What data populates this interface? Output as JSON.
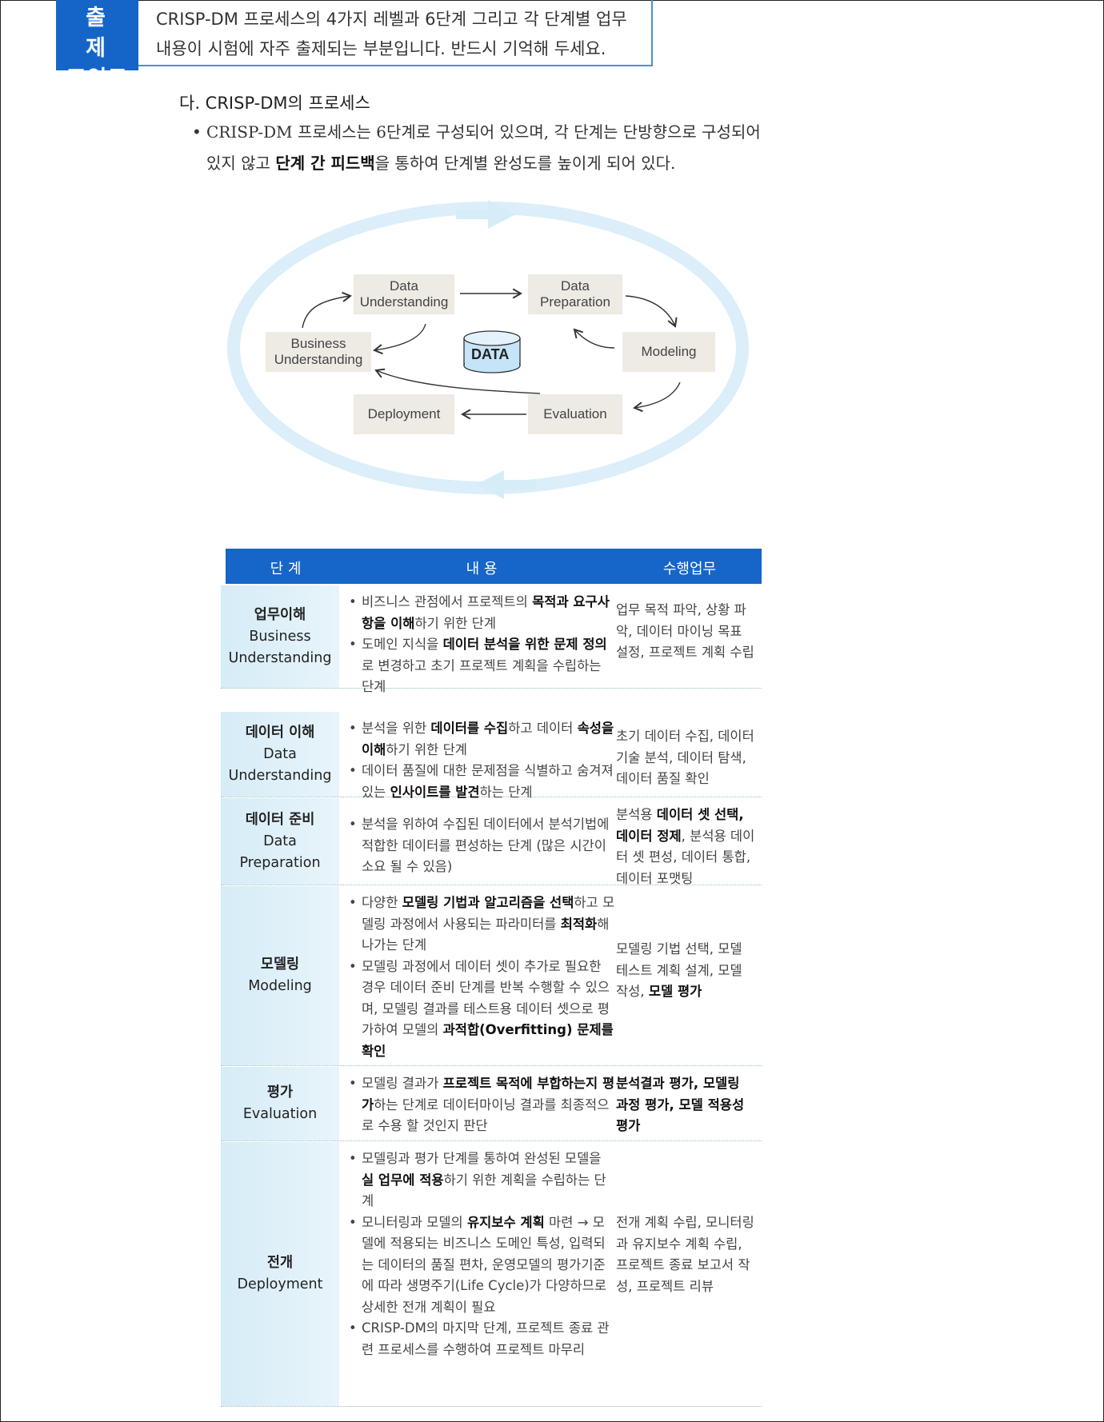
{
  "exam_point": {
    "badge_line1": "출 제",
    "badge_line2": "포인트",
    "text_line1": "CRISP-DM 프로세스의 4가지 레벨과 6단계 그리고 각 단계별 업무",
    "text_line2": "내용이 시험에 자주 출제되는 부분입니다. 반드시 기억해 두세요."
  },
  "section": {
    "title": "다. CRISP-DM의 프로세스",
    "bullet_pre": "CRISP-DM 프로세스는 6단계로 구성되어 있으며, 각 단계는 단방향으로 구성되어 있지 않고 ",
    "bullet_bold": "단계 간 피드백",
    "bullet_post": "을 통하여 단계별 완성도를 높이게 되어 있다."
  },
  "diagram": {
    "nodes": {
      "data_understanding": "Data Understanding",
      "data_preparation": "Data Preparation",
      "business_understanding": "Business Understanding",
      "modeling": "Modeling",
      "deployment": "Deployment",
      "evaluation": "Evaluation"
    },
    "database_label": "DATA"
  },
  "table": {
    "headers": [
      "단 계",
      "내 용",
      "수행업무"
    ],
    "rows": [
      {
        "stage_ko": "업무이해",
        "stage_en1": "Business",
        "stage_en2": "Understanding",
        "content": [
          [
            [
              "비즈니스 관점에서 프로젝트의 ",
              false
            ],
            [
              "목적과 요구사항을 이해",
              true
            ],
            [
              "하기 위한 단계",
              false
            ]
          ],
          [
            [
              "도메인 지식을 ",
              false
            ],
            [
              "데이터 분석을 위한 문제 정의",
              true
            ],
            [
              "로 변경하고 초기 프로젝트 계획을 수립하는 단계",
              false
            ]
          ]
        ],
        "task": [
          [
            "업무 목적 파악, 상황 파악, 데이터 마이닝 목표 설정, 프로젝트 계획 수립",
            false
          ]
        ]
      },
      {
        "stage_ko": "데이터 이해",
        "stage_en1": "Data",
        "stage_en2": "Understanding",
        "content": [
          [
            [
              "분석을 위한 ",
              false
            ],
            [
              "데이터를 수집",
              true
            ],
            [
              "하고 데이터 ",
              false
            ],
            [
              "속성을 이해",
              true
            ],
            [
              "하기 위한 단계",
              false
            ]
          ],
          [
            [
              "데이터 품질에 대한 문제점을 식별하고 숨겨져 있는 ",
              false
            ],
            [
              "인사이트를 발견",
              true
            ],
            [
              "하는 단계",
              false
            ]
          ]
        ],
        "task": [
          [
            "초기 데이터 수집, 데이터 기술 분석, 데이터 탐색, 데이터 품질 확인",
            false
          ]
        ]
      },
      {
        "stage_ko": "데이터 준비",
        "stage_en1": "Data",
        "stage_en2": "Preparation",
        "content": [
          [
            [
              "분석을 위하여 수집된 데이터에서 분석기법에 적합한 데이터를 편성하는 단계 (많은 시간이 소요 될 수 있음)",
              false
            ]
          ]
        ],
        "task": [
          [
            "분석용 ",
            false
          ],
          [
            "데이터 셋 선택, 데이터 정제",
            true
          ],
          [
            ", 분석용 데이터 셋 편성, 데이터 통합, 데이터 포맷팅",
            false
          ]
        ]
      },
      {
        "stage_ko": "모델링",
        "stage_en1": "Modeling",
        "stage_en2": "",
        "content": [
          [
            [
              "다양한 ",
              false
            ],
            [
              "모델링 기법과 알고리즘을 선택",
              true
            ],
            [
              "하고 모델링 과정에서 사용되는 파라미터를 ",
              false
            ],
            [
              "최적화",
              true
            ],
            [
              "해 나가는 단계",
              false
            ]
          ],
          [
            [
              "모델링 과정에서 데이터 셋이 추가로 필요한 경우 데이터 준비 단계를 반복 수행할 수 있으며, 모델링 결과를 테스트용 데이터 셋으로 평가하여 모델의 ",
              false
            ],
            [
              "과적합(Overfitting) 문제를 확인",
              true
            ]
          ]
        ],
        "task": [
          [
            "모델링 기법 선택, 모델 테스트 계획 설계, 모델 작성, ",
            false
          ],
          [
            "모델 평가",
            true
          ]
        ]
      },
      {
        "stage_ko": "평가",
        "stage_en1": "Evaluation",
        "stage_en2": "",
        "content": [
          [
            [
              "모델링 결과가 ",
              false
            ],
            [
              "프로젝트 목적에 부합하는지 평가",
              true
            ],
            [
              "하는 단계로 데이터마이닝 결과를 최종적으로 수용 할 것인지 판단",
              false
            ]
          ]
        ],
        "task": [
          [
            "분석결과 평가, 모델링 과정 평가, 모델 적용성 평가",
            true
          ]
        ]
      },
      {
        "stage_ko": "전개",
        "stage_en1": "Deployment",
        "stage_en2": "",
        "content": [
          [
            [
              "모델링과 평가 단계를 통하여 완성된 모델을 ",
              false
            ],
            [
              "실 업무에 적용",
              true
            ],
            [
              "하기 위한 계획을 수립하는 단계",
              false
            ]
          ],
          [
            [
              "모니터링과 모델의 ",
              false
            ],
            [
              "유지보수 계획",
              true
            ],
            [
              " 마련 → 모델에 적용되는 비즈니스 도메인 특성, 입력되는 데이터의 품질 편차, 운영모델의 평가기준에 따라 생명주기(Life Cycle)가 다양하므로 상세한 전개 계획이 필요",
              false
            ]
          ],
          [
            [
              "CRISP-DM의 마지막 단계, 프로젝트 종료 관련 프로세스를 수행하여 프로젝트 마무리",
              false
            ]
          ]
        ],
        "task": [
          [
            "전개 계획 수립, 모니터링과 유지보수 계획 수립, 프로젝트 종료 보고서 작성, 프로젝트 리뷰",
            false
          ]
        ]
      }
    ]
  },
  "colors": {
    "accent_blue": "#1665c8",
    "stage_bg": "#d6ecf7",
    "node_bg": "#eeebe5",
    "cycle_ring": "#dbeefa"
  }
}
